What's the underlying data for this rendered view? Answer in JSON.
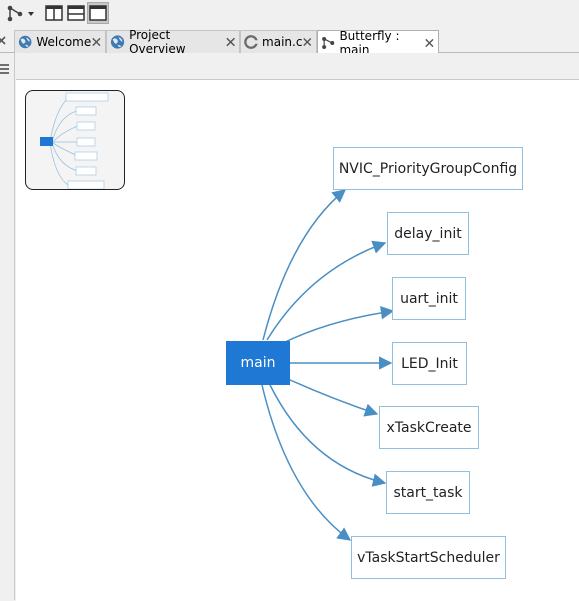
{
  "toolbar": {
    "buttons": [
      {
        "name": "hierarchy-dropdown-button",
        "icon": "hierarchy-icon"
      },
      {
        "name": "split-vertical-button",
        "icon": "split-vertical-icon"
      },
      {
        "name": "split-horizontal-button",
        "icon": "split-horizontal-icon"
      },
      {
        "name": "single-view-button",
        "icon": "single-view-icon",
        "pressed": true
      }
    ]
  },
  "tabs": [
    {
      "label": "Welcome",
      "icon": "globe-icon"
    },
    {
      "label": "Project Overview",
      "icon": "globe-icon"
    },
    {
      "label": "main.c",
      "icon": "c-file-icon"
    },
    {
      "label": "Butterfly : main",
      "icon": "hierarchy-icon",
      "active": true
    }
  ],
  "graph": {
    "root": "main",
    "callees": [
      "NVIC_PriorityGroupConfig",
      "delay_init",
      "uart_init",
      "LED_Init",
      "xTaskCreate",
      "start_task",
      "vTaskStartScheduler"
    ]
  },
  "colors": {
    "root_fill": "#1e78d4",
    "node_border": "#8fc0e0",
    "edge": "#4a8fc4"
  }
}
